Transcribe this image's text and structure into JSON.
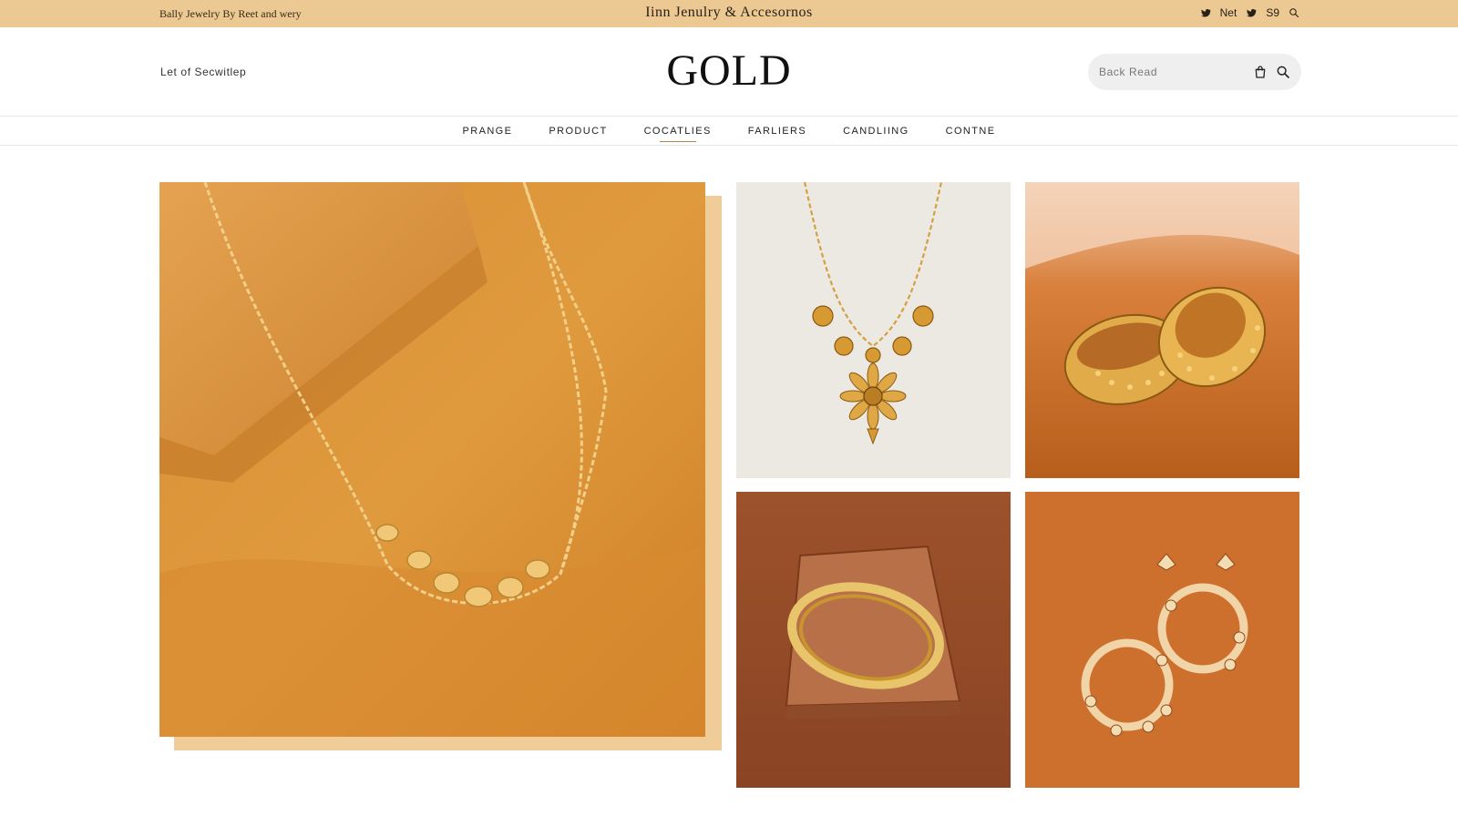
{
  "topbar": {
    "left_text": "Bally Jewelry  By Reet and wery",
    "center_text": "Iinn Jenulry & Accesornos",
    "social": [
      {
        "icon": "twitter-icon"
      },
      {
        "label": "Net"
      },
      {
        "icon": "twitter-icon"
      },
      {
        "label": "S9"
      },
      {
        "icon": "search-icon"
      }
    ]
  },
  "header": {
    "tagline": "Let of Secwitlep",
    "logo": "GOLD",
    "search": {
      "placeholder": "Back Read",
      "icons": [
        "shopping-bag-icon",
        "search-icon"
      ]
    }
  },
  "nav": {
    "items": [
      {
        "label": "PRANGE"
      },
      {
        "label": "PRODUCT"
      },
      {
        "label": "COCATLIES",
        "active": true
      },
      {
        "label": "FARLIERS"
      },
      {
        "label": "CANDLIING"
      },
      {
        "label": "CONTNE"
      }
    ]
  },
  "gallery": {
    "images": [
      "gold-necklace-on-orange-fabric",
      "gold-flower-pendant-necklace",
      "gold-filigree-rings",
      "gold-bangle-on-tray",
      "gold-floral-rings-on-orange"
    ]
  },
  "colors": {
    "topbar": "#ecc892",
    "hero_backdrop": "#efcc98",
    "accent": "#b5894a"
  }
}
